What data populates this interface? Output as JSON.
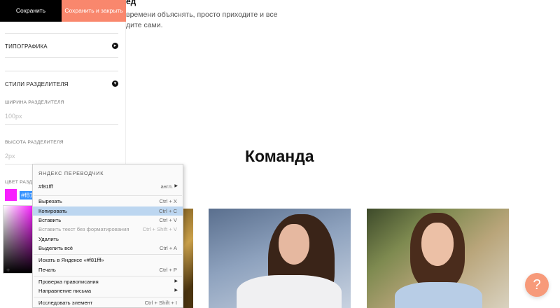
{
  "page": {
    "heading_fragment": "ед",
    "text_line1": "времени объяснять, просто приходите и все",
    "text_line2": "дите сами.",
    "section_title": "Команда",
    "help_label": "?"
  },
  "panel": {
    "save_label": "Сохранить",
    "save_close_label": "Сохранить и закрыть",
    "typography_label": "ТИПОГРАФИКА",
    "divider_styles_label": "СТИЛИ РАЗДЕЛИТЕЛЯ",
    "divider_width_label": "ШИРИНА РАЗДЕЛИТЕЛЯ",
    "divider_width_value": "100px",
    "divider_height_label": "ВЫСОТА РАЗДЕЛИТЕЛЯ",
    "divider_height_value": "2px",
    "divider_color_label": "ЦВЕТ РАЗДЕ",
    "divider_color_value": "#f81",
    "picker_plus": "+"
  },
  "context_menu": {
    "header": "ЯНДЕКС ПЕРЕВОДЧИК",
    "translate_source": "#f81fff",
    "translate_lang": "англ.",
    "items": [
      {
        "label": "Вырезать",
        "shortcut": "Ctrl + X"
      },
      {
        "label": "Копировать",
        "shortcut": "Ctrl + C"
      },
      {
        "label": "Вставить",
        "shortcut": "Ctrl + V"
      },
      {
        "label": "Вставить текст без форматирования",
        "shortcut": "Ctrl + Shift + V"
      },
      {
        "label": "Удалить",
        "shortcut": ""
      },
      {
        "label": "Выделить всё",
        "shortcut": "Ctrl + A"
      },
      {
        "label": "Искать в Яндексе «#f81fff»",
        "shortcut": ""
      },
      {
        "label": "Печать",
        "shortcut": "Ctrl + P"
      },
      {
        "label": "Проверка правописания",
        "shortcut": ""
      },
      {
        "label": "Направление письма",
        "shortcut": ""
      },
      {
        "label": "Исследовать элемент",
        "shortcut": "Ctrl + Shift + I"
      }
    ]
  },
  "colors": {
    "accent": "#f9876d",
    "selected_swatch": "#f81fff",
    "menu_highlight": "#bcd6f0"
  },
  "icons": {
    "section_expand": "circle-arrow-right-icon",
    "section_collapse": "circle-arrow-down-icon",
    "submenu": "triangle-right-icon"
  }
}
